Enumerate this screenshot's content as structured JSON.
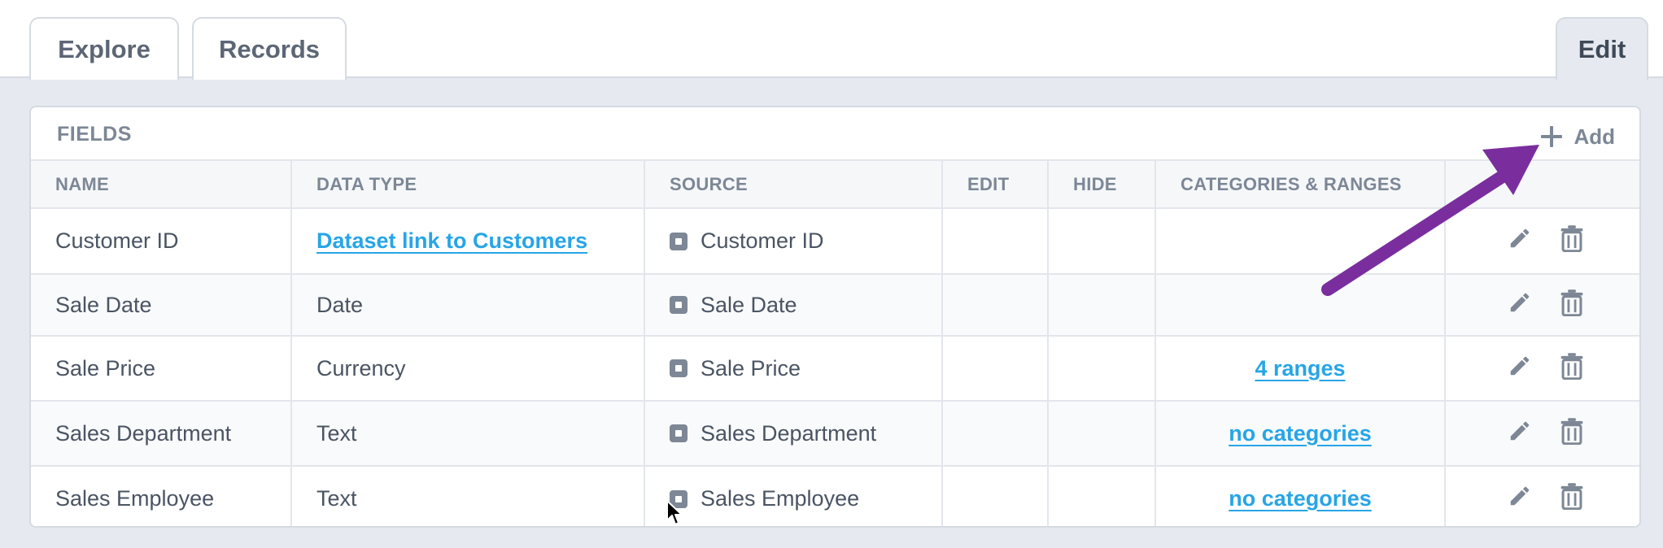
{
  "tabs": {
    "explore": "Explore",
    "records": "Records",
    "edit": "Edit"
  },
  "panel": {
    "title": "FIELDS",
    "add_label": "Add"
  },
  "table": {
    "columns": [
      "NAME",
      "DATA TYPE",
      "SOURCE",
      "EDIT",
      "HIDE",
      "CATEGORIES & RANGES",
      ""
    ],
    "rows": [
      {
        "name": "Customer ID",
        "data_type": "Dataset link to Customers",
        "data_type_is_link": true,
        "source": "Customer ID",
        "categories": ""
      },
      {
        "name": "Sale Date",
        "data_type": "Date",
        "source": "Sale Date",
        "categories": ""
      },
      {
        "name": "Sale Price",
        "data_type": "Currency",
        "source": "Sale Price",
        "categories": "4 ranges"
      },
      {
        "name": "Sales Department",
        "data_type": "Text",
        "source": "Sales Department",
        "categories": "no categories"
      },
      {
        "name": "Sales Employee",
        "data_type": "Text",
        "source": "Sales Employee",
        "categories": "no categories"
      }
    ]
  },
  "icons": {
    "add": "plus-icon",
    "source": "source-field-icon",
    "edit_row": "pencil-icon",
    "delete_row": "trash-icon",
    "annotation": "purple-arrow",
    "pointer": "mouse-cursor-icon"
  },
  "colors": {
    "link": "#27a5e6",
    "annotation_arrow": "#7a2e9e",
    "background": "#e6eaf0"
  }
}
